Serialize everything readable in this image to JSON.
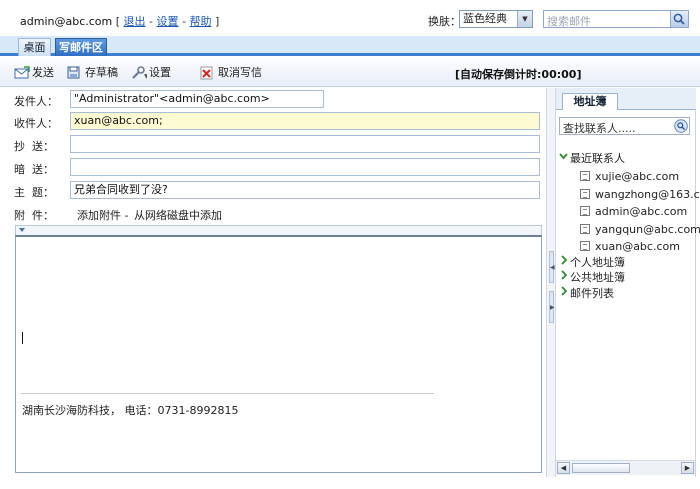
{
  "topbar": {
    "user_email": "admin@abc.com",
    "bracket_open": "[",
    "logout": "退出",
    "settings": "设置",
    "help": "帮助",
    "bracket_close": "]",
    "dash": "-",
    "skin_label": "换肤：",
    "skin_value": "蓝色经典",
    "search_placeholder": "搜索邮件"
  },
  "tabs": {
    "desktop": "桌面",
    "compose": "写邮件区"
  },
  "toolbar": {
    "send": "发送",
    "draft": "存草稿",
    "settings": "设置",
    "cancel": "取消写信",
    "autosave": "[自动保存倒计时:00:00]"
  },
  "compose": {
    "from_label": "发件人：",
    "from_value": "\"Administrator\"<admin@abc.com>",
    "to_label": "收件人：",
    "to_value": "xuan@abc.com;",
    "cc_label": "抄  送：",
    "cc_value": "",
    "bcc_label": "暗  送：",
    "bcc_value": "",
    "subject_label": "主  题：",
    "subject_value": "兄弟合同收到了没?",
    "attach_label": "附  件：",
    "attach_add": "添加附件 -",
    "attach_disk": "从网络磁盘中添加",
    "signature": "湖南长沙海防科技，  电话：0731-8992815"
  },
  "addressbook": {
    "tab": "地址簿",
    "search_placeholder": "查找联系人.....",
    "recent": "最近联系人",
    "contacts": [
      "xujie@abc.com",
      "wangzhong@163.c",
      "admin@abc.com",
      "yangqun@abc.com",
      "xuan@abc.com"
    ],
    "personal": "个人地址簿",
    "public": "公共地址簿",
    "mail_list": "邮件列表"
  },
  "colors": {
    "accent": "#3d7fd0",
    "to_field_bg": "#fdfbd2",
    "link": "#1a56b5"
  }
}
